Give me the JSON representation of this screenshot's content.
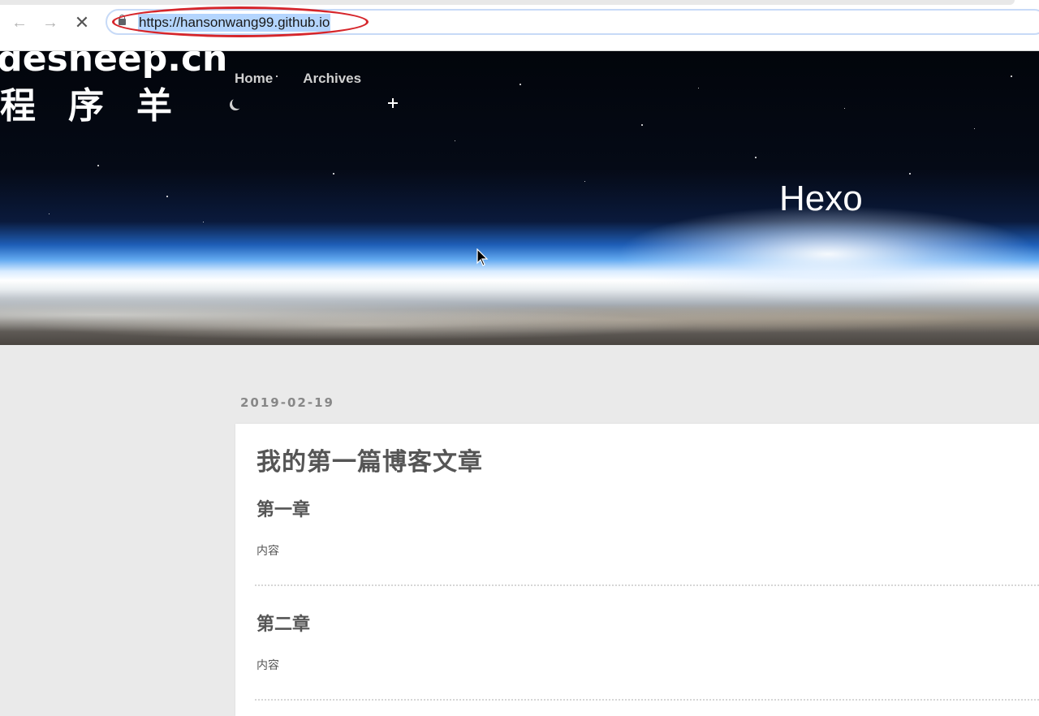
{
  "browser": {
    "back_icon": "arrow-left-icon",
    "forward_icon": "arrow-right-icon",
    "stop_icon": "close-icon",
    "url": "https://hansonwang99.github.io",
    "annotation_color": "#d6262b"
  },
  "watermark": {
    "domain": "odesheep.cn",
    "chinese": "程序羊"
  },
  "site": {
    "nav": [
      {
        "label": "Home"
      },
      {
        "label": "Archives"
      }
    ],
    "title": "Hexo"
  },
  "post": {
    "date": "2019-02-19",
    "title": "我的第一篇博客文章",
    "sections": [
      {
        "heading": "第一章",
        "body": "内容"
      },
      {
        "heading": "第二章",
        "body": "内容"
      }
    ]
  }
}
